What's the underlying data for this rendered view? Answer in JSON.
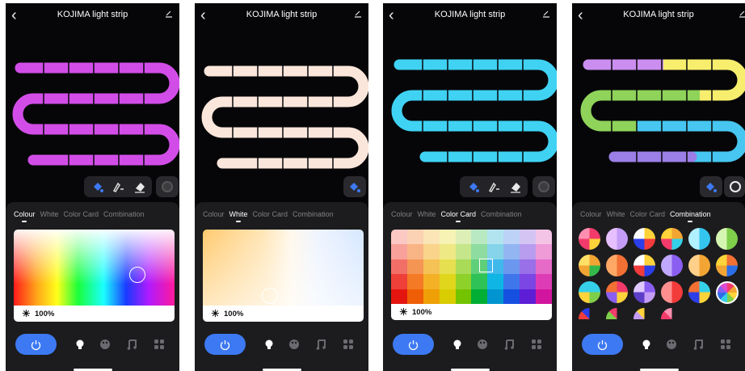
{
  "app": {
    "title": "KOJIMA light strip"
  },
  "tabs": [
    "Colour",
    "White",
    "Color Card",
    "Combination"
  ],
  "brightness": "100%",
  "screens": [
    {
      "active_tab": 0,
      "strip_color": "#d24de8"
    },
    {
      "active_tab": 1,
      "strip_color": "#fbe6db"
    },
    {
      "active_tab": 2,
      "strip_color": "#3fd2f3"
    },
    {
      "active_tab": 3,
      "strip_color": "#46c6f0"
    }
  ],
  "colors": {
    "accent": "#3d79f2",
    "panel": "#1c1c1e",
    "background": "#060608"
  },
  "icons": [
    "back-icon",
    "edit-icon",
    "paint-bucket-icon",
    "brush-icon",
    "eraser-icon",
    "record-icon",
    "power-icon",
    "bulb-icon",
    "palette-icon",
    "music-icon",
    "scene-grid-icon",
    "sun-icon"
  ]
}
